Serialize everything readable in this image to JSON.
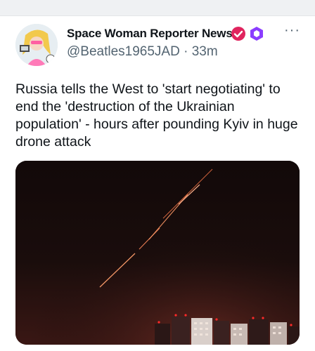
{
  "post": {
    "author_name": "Space Woman Reporter News",
    "author_handle": "@Beatles1965JAD",
    "separator": "·",
    "time_ago": "33m",
    "text": "Russia tells the West to 'start negotiating' to end the 'destruction of the Ukrainian population' - hours after pounding Kyiv in huge drone attack"
  },
  "icons": {
    "more": "more-horizontal-icon",
    "verified": "verified-badge-icon",
    "hexagon": "hexagon-badge-icon"
  },
  "colors": {
    "verified_badge": "#e0245e",
    "hex_badge": "#8b3dff",
    "text_primary": "#0f1419",
    "text_secondary": "#536471",
    "night_sky": "#150b0a",
    "tracer": "#ff8a5c"
  }
}
